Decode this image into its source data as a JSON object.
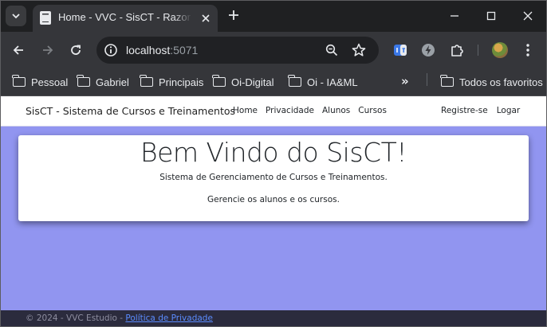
{
  "browser": {
    "tab": {
      "title": "Home - VVC - SisCT - Razor Pages",
      "favicon": "document-icon"
    },
    "window_controls": [
      "minimize-icon",
      "maximize-icon",
      "close-icon"
    ],
    "address_bar": {
      "host": "localhost",
      "port": ":5071"
    },
    "bookmarks": [
      {
        "label": "Pessoal",
        "icon": "folder-icon"
      },
      {
        "label": "Gabriel",
        "icon": "folder-icon"
      },
      {
        "label": "Principais",
        "icon": "folder-icon"
      },
      {
        "label": "Oi-Digital",
        "icon": "folder-icon"
      },
      {
        "label": "Oi - IA&ML",
        "icon": "folder-icon"
      }
    ],
    "bookmarks_overflow": "»",
    "all_bookmarks": {
      "label": "Todos os favoritos",
      "icon": "folder-icon"
    }
  },
  "site": {
    "brand": "SisCT - Sistema de Cursos e Treinamentos",
    "nav": [
      "Home",
      "Privacidade",
      "Alunos",
      "Cursos"
    ],
    "nav_right": [
      "Registre-se",
      "Logar"
    ],
    "hero": {
      "title": "Bem Vindo do SisCT!",
      "subtitle": "Sistema de Gerenciamento de Cursos e Treinamentos.",
      "text": "Gerencie os alunos e os cursos."
    },
    "footer": {
      "text": "© 2024 - VVC Estudio - ",
      "link": "Política de Privadade"
    },
    "colors": {
      "page_background": "#9195f0",
      "footer_background": "#2b2b3d",
      "link": "#5b8cff"
    }
  }
}
